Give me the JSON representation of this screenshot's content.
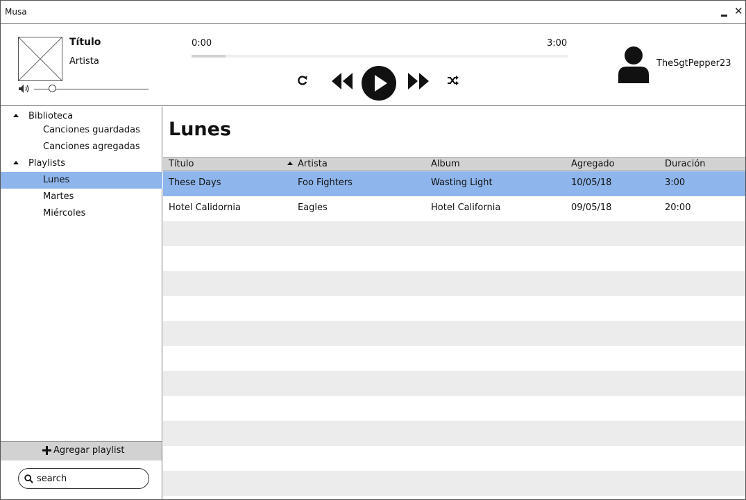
{
  "window": {
    "title": "Musa",
    "minimize_icon": "minimize-icon",
    "close_icon": "close-icon",
    "close_glyph": "✕"
  },
  "player": {
    "track_title": "Título",
    "track_artist": "Artista",
    "time_current": "0:00",
    "time_total": "3:00",
    "progress_fraction": 0.09,
    "volume_fraction": 0.13,
    "controls": [
      "repeat-icon",
      "rewind-icon",
      "play-icon",
      "fast-forward-icon",
      "shuffle-icon"
    ],
    "user_name": "TheSgtPepper23"
  },
  "sidebar": {
    "tree": [
      {
        "label": "Biblioteca",
        "level": 0,
        "expanded": true,
        "selected": false
      },
      {
        "label": "Canciones guardadas",
        "level": 1,
        "selected": false
      },
      {
        "label": "Canciones agregadas",
        "level": 1,
        "selected": false
      },
      {
        "label": "Playlists",
        "level": 0,
        "expanded": true,
        "selected": false
      },
      {
        "label": "Lunes",
        "level": 1,
        "selected": true
      },
      {
        "label": "Martes",
        "level": 1,
        "selected": false
      },
      {
        "label": "Miércoles",
        "level": 1,
        "selected": false
      }
    ],
    "add_playlist_label": "Agregar playlist",
    "search_placeholder": "search"
  },
  "main": {
    "page_title": "Lunes",
    "table": {
      "columns": [
        "Título",
        "Artista",
        "Album",
        "Agregado",
        "Duración"
      ],
      "sorted_column": 1,
      "rows": [
        [
          "These Days",
          "Foo Fighters",
          "Wasting Light",
          "10/05/18",
          "3:00"
        ],
        [
          "Hotel Calidornia",
          "Eagles",
          "Hotel California",
          "09/05/18",
          "20:00"
        ]
      ],
      "selected_row": 0
    }
  },
  "colors": {
    "selection": "#8fb6ec",
    "header_bg": "#d2d2d2",
    "stripe": "#ececec",
    "icon": "#111111"
  }
}
